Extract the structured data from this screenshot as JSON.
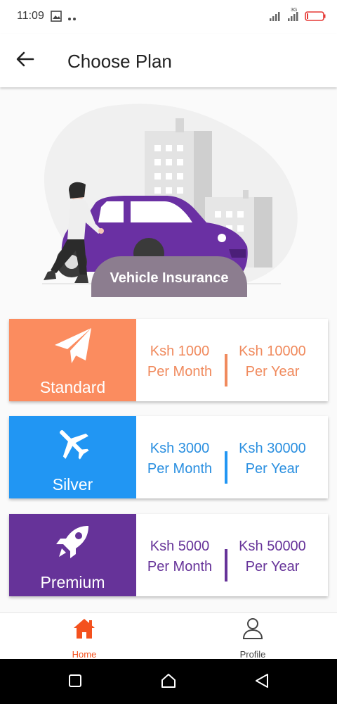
{
  "status_bar": {
    "time": "11:09",
    "network_label": "3G",
    "battery_color": "#e53935"
  },
  "app_bar": {
    "title": "Choose Plan",
    "back_icon": "arrow-left-icon"
  },
  "hero": {
    "banner_text": "Vehicle Insurance",
    "illustration": "woman-with-car-city-illustration",
    "car_color": "#6a30a3",
    "blob_color": "#f0f0f0"
  },
  "plans": [
    {
      "name": "Standard",
      "icon": "paper-plane-icon",
      "color": "#fb8c5f",
      "monthly_price": "Ksh 1000",
      "monthly_period": "Per Month",
      "yearly_price": "Ksh 10000",
      "yearly_period": "Per Year"
    },
    {
      "name": "Silver",
      "icon": "airplane-icon",
      "color": "#2196f3",
      "monthly_price": "Ksh 3000",
      "monthly_period": "Per Month",
      "yearly_price": "Ksh 30000",
      "yearly_period": "Per Year"
    },
    {
      "name": "Premium",
      "icon": "rocket-icon",
      "color": "#663399",
      "monthly_price": "Ksh 5000",
      "monthly_period": "Per Month",
      "yearly_price": "Ksh 50000",
      "yearly_period": "Per Year"
    }
  ],
  "bottom_nav": {
    "items": [
      {
        "label": "Home",
        "icon": "home-icon",
        "active": true,
        "color": "#f4511e"
      },
      {
        "label": "Profile",
        "icon": "person-icon",
        "active": false,
        "color": "#444444"
      }
    ]
  },
  "system_nav": {
    "buttons": [
      "recent-apps-icon",
      "home-circle-icon",
      "back-triangle-icon"
    ]
  }
}
